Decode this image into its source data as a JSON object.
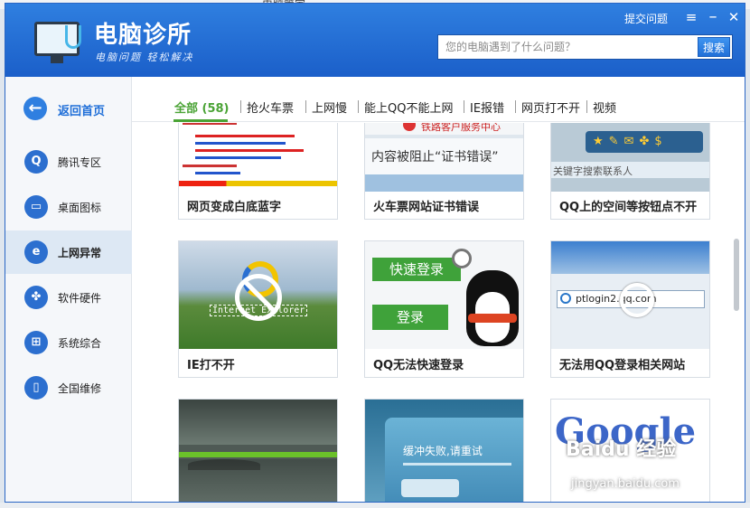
{
  "background": {
    "partial_title": "电脑管家"
  },
  "header": {
    "app_title": "电脑诊所",
    "slogan": "电脑问题 轻松解决",
    "submit_link": "提交问题",
    "menu_icon": "≡",
    "close_icon": "✕"
  },
  "search": {
    "placeholder": "您的电脑遇到了什么问题？",
    "button": "搜索"
  },
  "sidebar": {
    "back_label": "返回首页",
    "items": [
      {
        "label": "腾讯专区",
        "icon": "qq-penguin-icon",
        "glyph": "Q"
      },
      {
        "label": "桌面图标",
        "icon": "monitor-icon",
        "glyph": "▭"
      },
      {
        "label": "上网异常",
        "icon": "ie-icon",
        "glyph": "e"
      },
      {
        "label": "软件硬件",
        "icon": "dots-icon",
        "glyph": "✤"
      },
      {
        "label": "系统综合",
        "icon": "windows-icon",
        "glyph": "⊞"
      },
      {
        "label": "全国维修",
        "icon": "phone-icon",
        "glyph": "▯"
      }
    ]
  },
  "tabs": [
    {
      "label": "全部 (58)"
    },
    {
      "label": "抢火车票"
    },
    {
      "label": "上网慢"
    },
    {
      "label": "能上QQ不能上网"
    },
    {
      "label": "IE报错"
    },
    {
      "label": "网页打不开"
    },
    {
      "label": "视频"
    }
  ],
  "cards": [
    {
      "caption": "网页变成白底蓝字"
    },
    {
      "caption": "火车票网站证书错误",
      "thumb_texts": [
        "铁路客户服务中心",
        "内容被阻止“证书错误”"
      ]
    },
    {
      "caption": "QQ上的空间等按钮点不开",
      "thumb_texts": [
        "关键字搜索联系人"
      ]
    },
    {
      "caption": "IE打不开",
      "thumb_texts": [
        "Internet Explorer"
      ]
    },
    {
      "caption": "QQ无法快速登录",
      "thumb_texts": [
        "快速登录",
        "登录"
      ]
    },
    {
      "caption": "无法用QQ登录相关网站",
      "thumb_texts": [
        "ptlogin2.qq.com"
      ]
    },
    {
      "caption": "",
      "thumb_texts": []
    },
    {
      "caption": "",
      "thumb_texts": [
        "缓冲失败,请重试"
      ]
    },
    {
      "caption": "",
      "thumb_texts": [
        "Google"
      ]
    }
  ],
  "watermark": {
    "brand": "Baidu 经验",
    "url": "jingyan.baidu.com"
  }
}
